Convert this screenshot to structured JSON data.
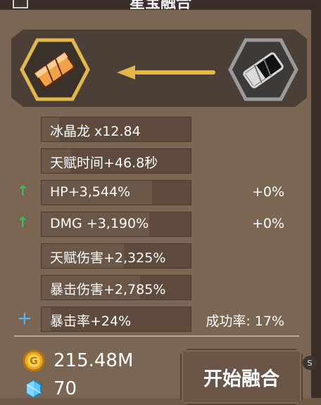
{
  "header": {
    "title": "星宝融合"
  },
  "fusion": {
    "left_item_icon": "orange-crystal-icon",
    "right_item_icon": "gray-crystal-icon",
    "arrow_icon": "left-arrow-icon"
  },
  "stats": [
    {
      "label": "冰晶龙 x12.84",
      "fill": 0.12,
      "right": "",
      "indicator": ""
    },
    {
      "label": "天赋时间+46.8秒",
      "fill": 0.2,
      "right": "",
      "indicator": ""
    },
    {
      "label": "HP+3,544%",
      "fill": 0.74,
      "right": "+0%",
      "indicator": "up-arrow-icon"
    },
    {
      "label": "DMG +3,190%",
      "fill": 0.72,
      "right": "+0%",
      "indicator": "up-arrow-icon"
    },
    {
      "label": "天赋伤害+2,325%",
      "fill": 0.55,
      "right": "",
      "indicator": ""
    },
    {
      "label": "暴击伤害+2,785%",
      "fill": 0.66,
      "right": "",
      "indicator": ""
    },
    {
      "label": "暴击率+24%",
      "fill": 0.06,
      "right": "成功率: 17%",
      "indicator": "plus-icon"
    }
  ],
  "currency": {
    "gold_icon": "gold-coin-icon",
    "gold": "215.48M",
    "gem_icon": "diamond-icon",
    "gems": "70"
  },
  "action": {
    "fuse_label": "开始融合",
    "badge": "S"
  },
  "colors": {
    "background": "#7b6553",
    "row": "#5e4b3e",
    "accent_gold": "#e2b84a",
    "up_green": "#34c15a",
    "plus_blue": "#4fb8ff"
  }
}
